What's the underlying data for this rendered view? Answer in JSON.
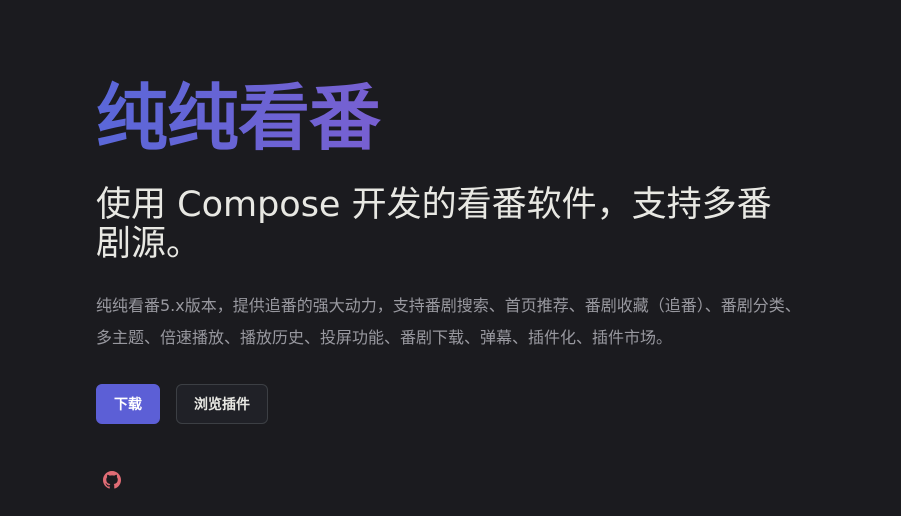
{
  "hero": {
    "name": "纯纯看番",
    "tagline": "使用 Compose 开发的看番软件，支持多番剧源。",
    "description": "纯纯看番5.x版本，提供追番的强大动力，支持番剧搜索、首页推荐、番剧收藏（追番）、番剧分类、多主题、倍速播放、播放历史、投屏功能、番剧下载、弹幕、插件化、插件市场。"
  },
  "actions": {
    "download_label": "下载",
    "browse_plugins_label": "浏览插件"
  },
  "social": {
    "icon": "github-icon"
  },
  "colors": {
    "background": "#1b1b1f",
    "brand": "#5c5fd6",
    "title_gradient_start": "#5a67d8",
    "title_gradient_end": "#9b59b6",
    "github_icon": "#e06c75"
  }
}
